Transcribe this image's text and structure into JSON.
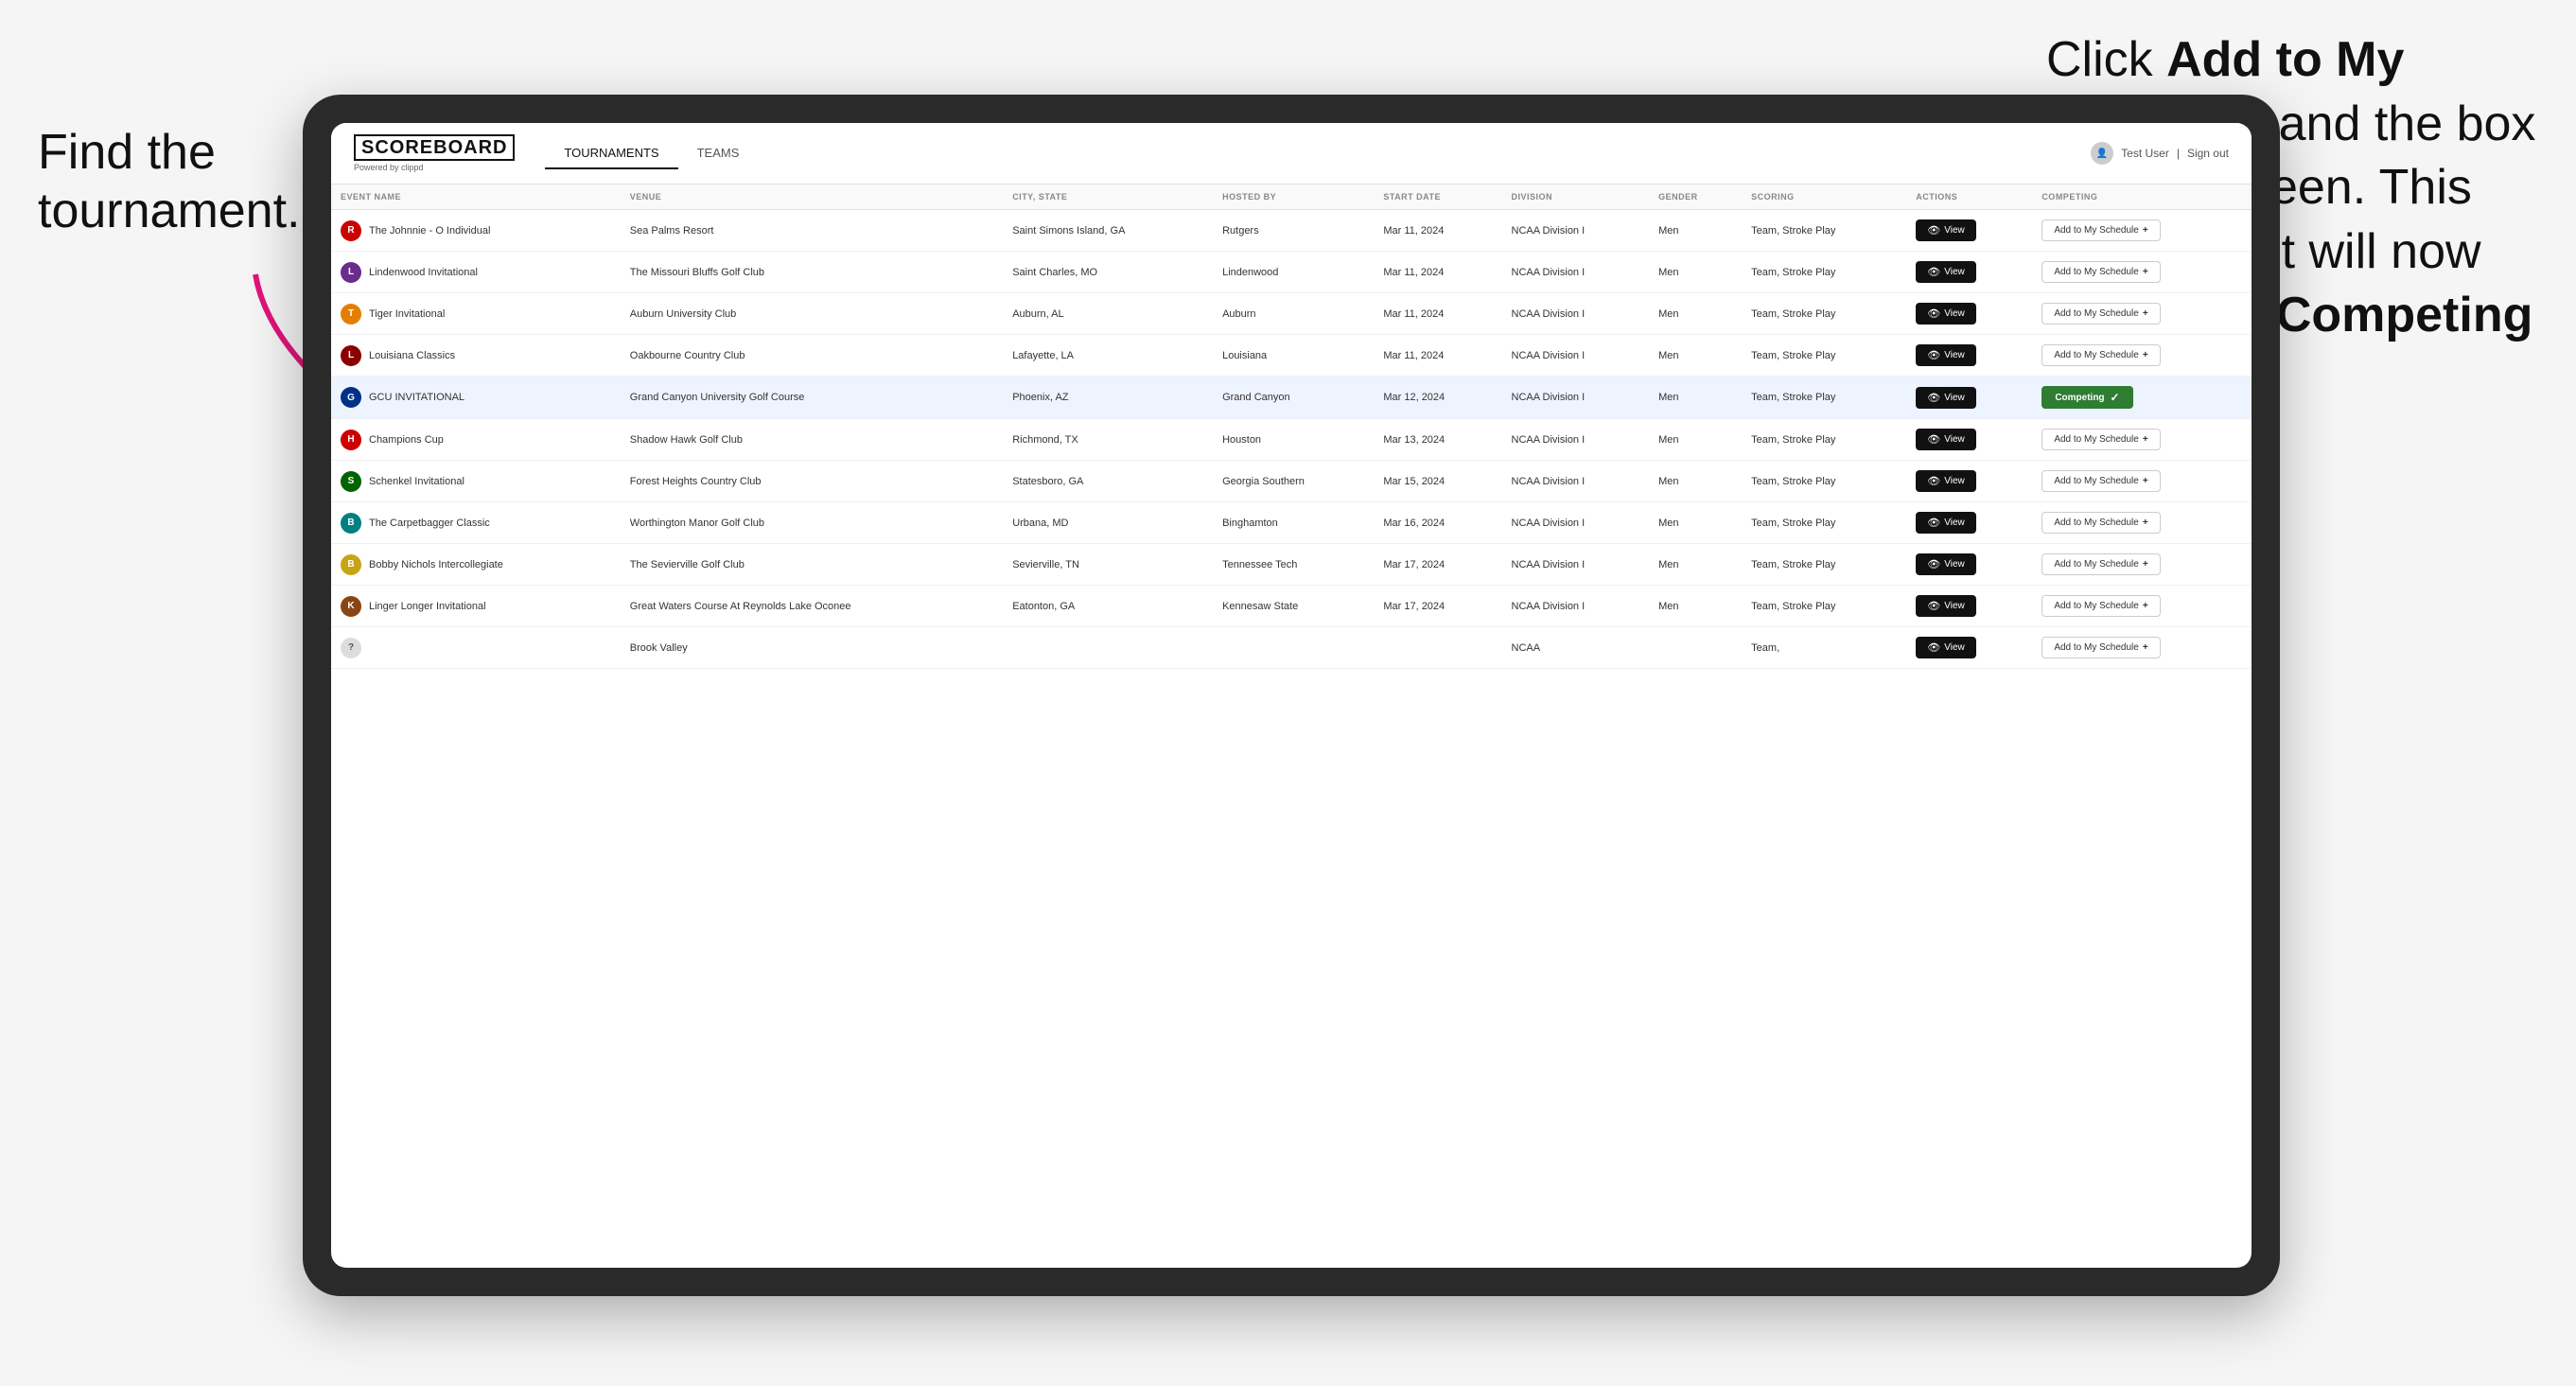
{
  "annotations": {
    "left_text_line1": "Find the",
    "left_text_line2": "tournament.",
    "right_text_html": "Click <b>Add to My Schedule</b> and the box will turn green. This tournament will now be in your <b>Competing</b> section."
  },
  "nav": {
    "logo": "SCOREBOARD",
    "logo_sub": "Powered by clippd",
    "tabs": [
      "TOURNAMENTS",
      "TEAMS"
    ],
    "active_tab": "TOURNAMENTS",
    "user": "Test User",
    "sign_out": "Sign out"
  },
  "table": {
    "columns": [
      "EVENT NAME",
      "VENUE",
      "CITY, STATE",
      "HOSTED BY",
      "START DATE",
      "DIVISION",
      "GENDER",
      "SCORING",
      "ACTIONS",
      "COMPETING"
    ],
    "rows": [
      {
        "id": 1,
        "logo_letter": "R",
        "logo_class": "red",
        "event_name": "The Johnnie - O Individual",
        "venue": "Sea Palms Resort",
        "city_state": "Saint Simons Island, GA",
        "hosted_by": "Rutgers",
        "start_date": "Mar 11, 2024",
        "division": "NCAA Division I",
        "gender": "Men",
        "scoring": "Team, Stroke Play",
        "competing_status": "add",
        "highlighted": false
      },
      {
        "id": 2,
        "logo_letter": "L",
        "logo_class": "purple",
        "event_name": "Lindenwood Invitational",
        "venue": "The Missouri Bluffs Golf Club",
        "city_state": "Saint Charles, MO",
        "hosted_by": "Lindenwood",
        "start_date": "Mar 11, 2024",
        "division": "NCAA Division I",
        "gender": "Men",
        "scoring": "Team, Stroke Play",
        "competing_status": "add",
        "highlighted": false
      },
      {
        "id": 3,
        "logo_letter": "T",
        "logo_class": "orange",
        "event_name": "Tiger Invitational",
        "venue": "Auburn University Club",
        "city_state": "Auburn, AL",
        "hosted_by": "Auburn",
        "start_date": "Mar 11, 2024",
        "division": "NCAA Division I",
        "gender": "Men",
        "scoring": "Team, Stroke Play",
        "competing_status": "add",
        "highlighted": false
      },
      {
        "id": 4,
        "logo_letter": "L",
        "logo_class": "darkred",
        "event_name": "Louisiana Classics",
        "venue": "Oakbourne Country Club",
        "city_state": "Lafayette, LA",
        "hosted_by": "Louisiana",
        "start_date": "Mar 11, 2024",
        "division": "NCAA Division I",
        "gender": "Men",
        "scoring": "Team, Stroke Play",
        "competing_status": "add",
        "highlighted": false
      },
      {
        "id": 5,
        "logo_letter": "G",
        "logo_class": "blue",
        "event_name": "GCU INVITATIONAL",
        "venue": "Grand Canyon University Golf Course",
        "city_state": "Phoenix, AZ",
        "hosted_by": "Grand Canyon",
        "start_date": "Mar 12, 2024",
        "division": "NCAA Division I",
        "gender": "Men",
        "scoring": "Team, Stroke Play",
        "competing_status": "competing",
        "highlighted": true
      },
      {
        "id": 6,
        "logo_letter": "H",
        "logo_class": "scarlet",
        "event_name": "Champions Cup",
        "venue": "Shadow Hawk Golf Club",
        "city_state": "Richmond, TX",
        "hosted_by": "Houston",
        "start_date": "Mar 13, 2024",
        "division": "NCAA Division I",
        "gender": "Men",
        "scoring": "Team, Stroke Play",
        "competing_status": "add",
        "highlighted": false
      },
      {
        "id": 7,
        "logo_letter": "S",
        "logo_class": "green",
        "event_name": "Schenkel Invitational",
        "venue": "Forest Heights Country Club",
        "city_state": "Statesboro, GA",
        "hosted_by": "Georgia Southern",
        "start_date": "Mar 15, 2024",
        "division": "NCAA Division I",
        "gender": "Men",
        "scoring": "Team, Stroke Play",
        "competing_status": "add",
        "highlighted": false
      },
      {
        "id": 8,
        "logo_letter": "B",
        "logo_class": "teal",
        "event_name": "The Carpetbagger Classic",
        "venue": "Worthington Manor Golf Club",
        "city_state": "Urbana, MD",
        "hosted_by": "Binghamton",
        "start_date": "Mar 16, 2024",
        "division": "NCAA Division I",
        "gender": "Men",
        "scoring": "Team, Stroke Play",
        "competing_status": "add",
        "highlighted": false
      },
      {
        "id": 9,
        "logo_letter": "B",
        "logo_class": "gold",
        "event_name": "Bobby Nichols Intercollegiate",
        "venue": "The Sevierville Golf Club",
        "city_state": "Sevierville, TN",
        "hosted_by": "Tennessee Tech",
        "start_date": "Mar 17, 2024",
        "division": "NCAA Division I",
        "gender": "Men",
        "scoring": "Team, Stroke Play",
        "competing_status": "add",
        "highlighted": false
      },
      {
        "id": 10,
        "logo_letter": "K",
        "logo_class": "brown",
        "event_name": "Linger Longer Invitational",
        "venue": "Great Waters Course At Reynolds Lake Oconee",
        "city_state": "Eatonton, GA",
        "hosted_by": "Kennesaw State",
        "start_date": "Mar 17, 2024",
        "division": "NCAA Division I",
        "gender": "Men",
        "scoring": "Team, Stroke Play",
        "competing_status": "add",
        "highlighted": false
      },
      {
        "id": 11,
        "logo_letter": "?",
        "logo_class": "",
        "event_name": "",
        "venue": "Brook Valley",
        "city_state": "",
        "hosted_by": "",
        "start_date": "",
        "division": "NCAA",
        "gender": "",
        "scoring": "Team,",
        "competing_status": "add",
        "highlighted": false
      }
    ],
    "buttons": {
      "view": "View",
      "add_to_schedule": "Add to My Schedule",
      "add_to_schedule_plus": "+",
      "competing": "Competing",
      "competing_check": "✓"
    }
  }
}
